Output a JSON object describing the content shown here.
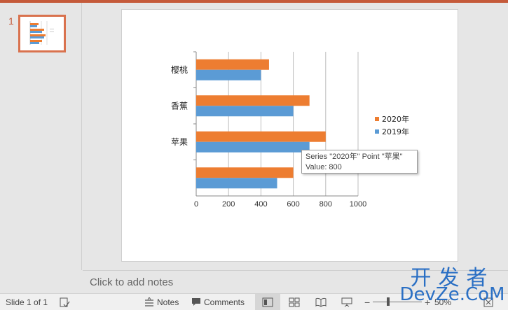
{
  "thumbnails": {
    "slide_number": "1"
  },
  "notes": {
    "placeholder": "Click to add notes"
  },
  "status": {
    "slide_indicator": "Slide 1 of 1",
    "notes_label": "Notes",
    "comments_label": "Comments",
    "zoom": "50%"
  },
  "watermark": {
    "cn": "开发者",
    "en": "DevZe.CoM"
  },
  "tooltip": {
    "line1": "Series \"2020年\" Point \"苹果\"",
    "line2": "Value: 800"
  },
  "colors": {
    "accent": "#c55a3a",
    "series_2020": "#ed7d31",
    "series_2019": "#5b9bd5"
  },
  "chart_data": {
    "type": "bar",
    "orientation": "horizontal",
    "categories": [
      "",
      "苹果",
      "香蕉",
      "樱桃"
    ],
    "series": [
      {
        "name": "2019年",
        "values": [
          500,
          700,
          600,
          400
        ]
      },
      {
        "name": "2020年",
        "values": [
          600,
          800,
          700,
          450
        ]
      }
    ],
    "xlim": [
      0,
      1000
    ],
    "x_ticks": [
      "0",
      "200",
      "400",
      "600",
      "800",
      "1000"
    ],
    "grid": true,
    "legend_position": "right"
  }
}
